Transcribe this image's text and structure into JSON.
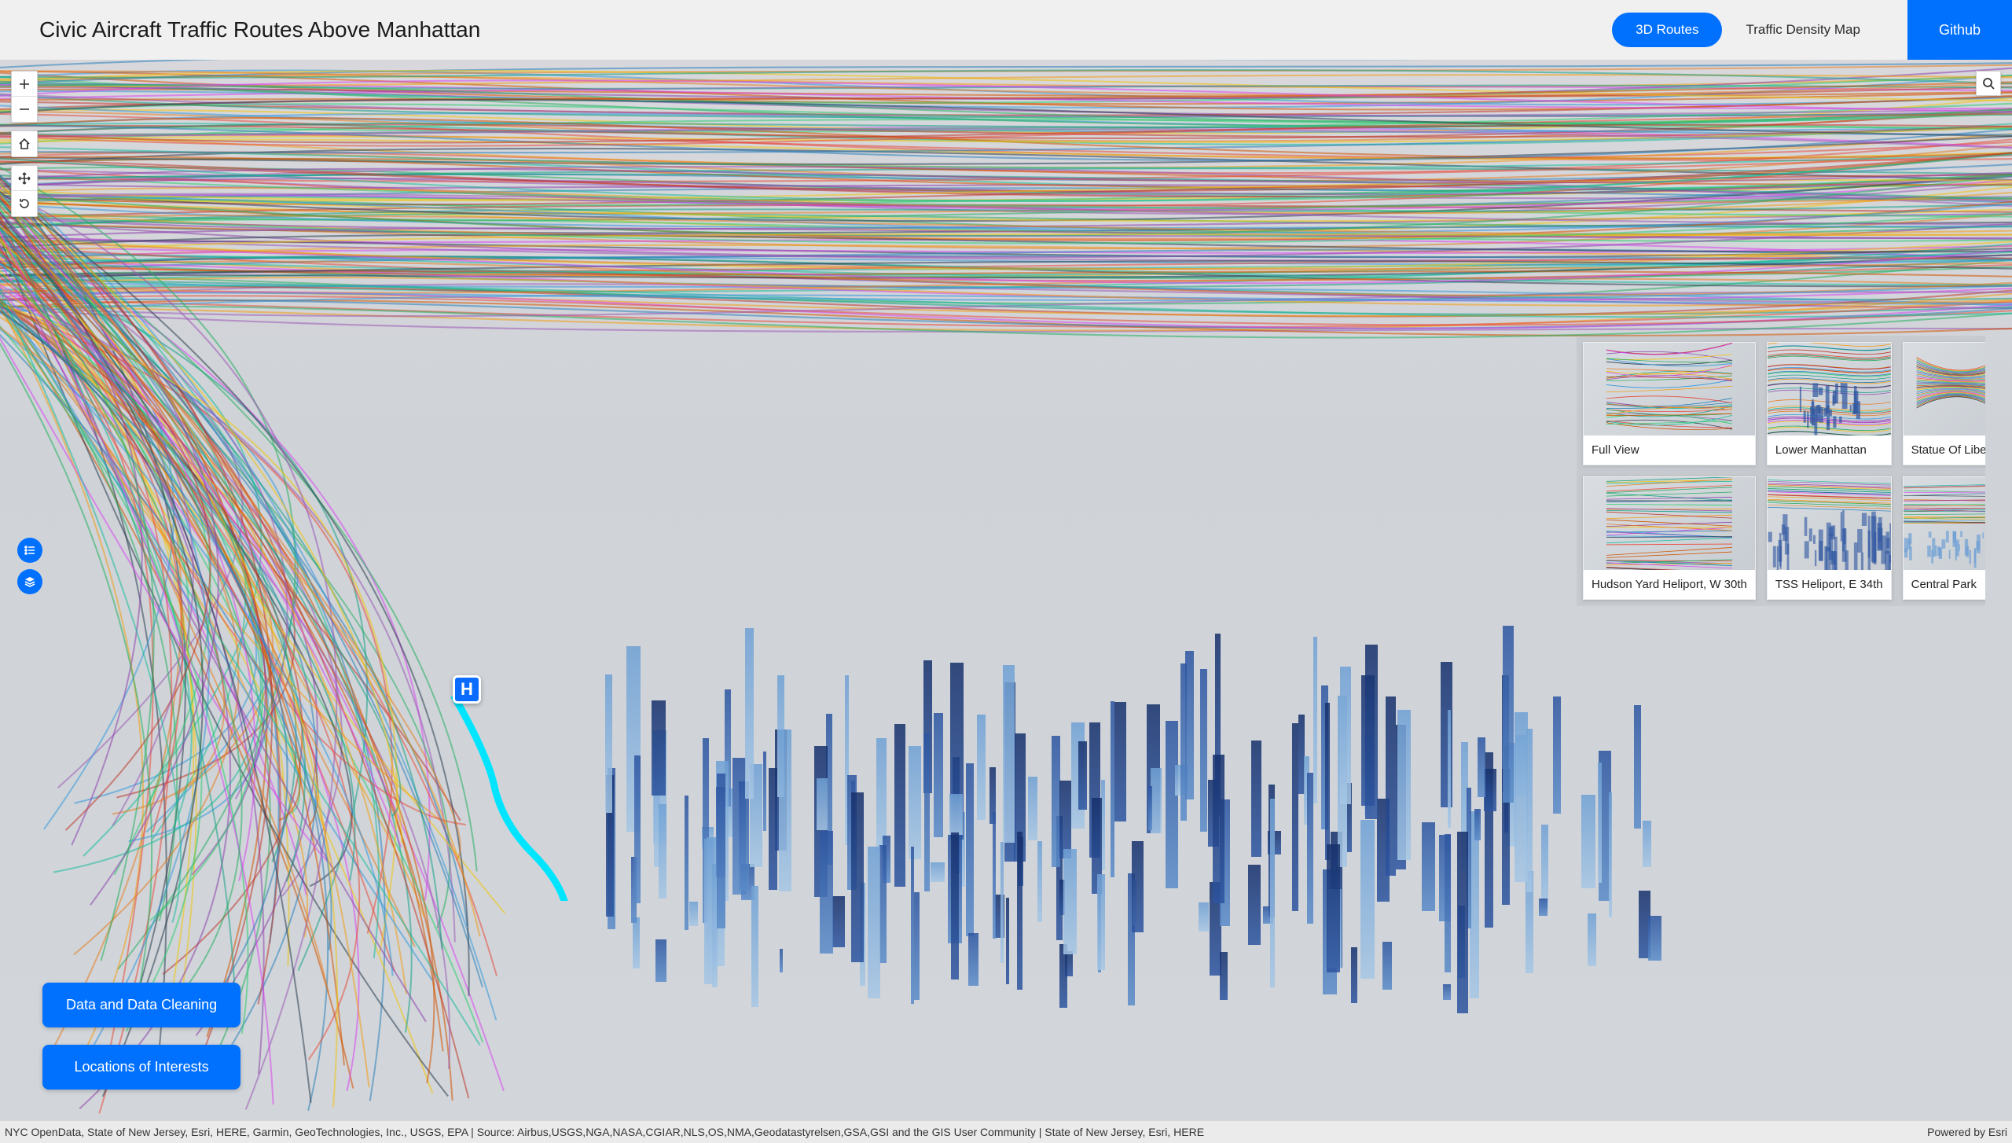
{
  "header": {
    "title": "Civic Aircraft Traffic Routes Above Manhattan",
    "nav": {
      "routes3d": "3D Routes",
      "density": "Traffic Density Map",
      "github": "Github"
    }
  },
  "heli_marker": {
    "label": "H"
  },
  "bookmarks": [
    {
      "label": "Full View"
    },
    {
      "label": "Lower Manhattan"
    },
    {
      "label": "Statue Of Liberty"
    },
    {
      "label": "Hudson Yard Heliport, W 30th"
    },
    {
      "label": "TSS Heliport, E 34th"
    },
    {
      "label": "Central Park"
    }
  ],
  "actions": {
    "data_cleaning": "Data and Data Cleaning",
    "locations": "Locations of Interests"
  },
  "attribution": {
    "text": "NYC OpenData, State of New Jersey, Esri, HERE, Garmin, GeoTechnologies, Inc., USGS, EPA | Source: Airbus,USGS,NGA,NASA,CGIAR,NLS,OS,NMA,Geodatastyrelsen,GSA,GSI and the GIS User Community | State of New Jersey, Esri, HERE",
    "powered_by": "Powered by Esri"
  },
  "trace_colors": [
    "#e74c3c",
    "#f39c12",
    "#27ae60",
    "#2980b9",
    "#8e44ad",
    "#16a085",
    "#d35400",
    "#2c3e50",
    "#c0392b",
    "#f1c40f",
    "#1abc9c",
    "#9b59b6",
    "#3498db",
    "#e67e22",
    "#2ecc71",
    "#d946ef"
  ]
}
